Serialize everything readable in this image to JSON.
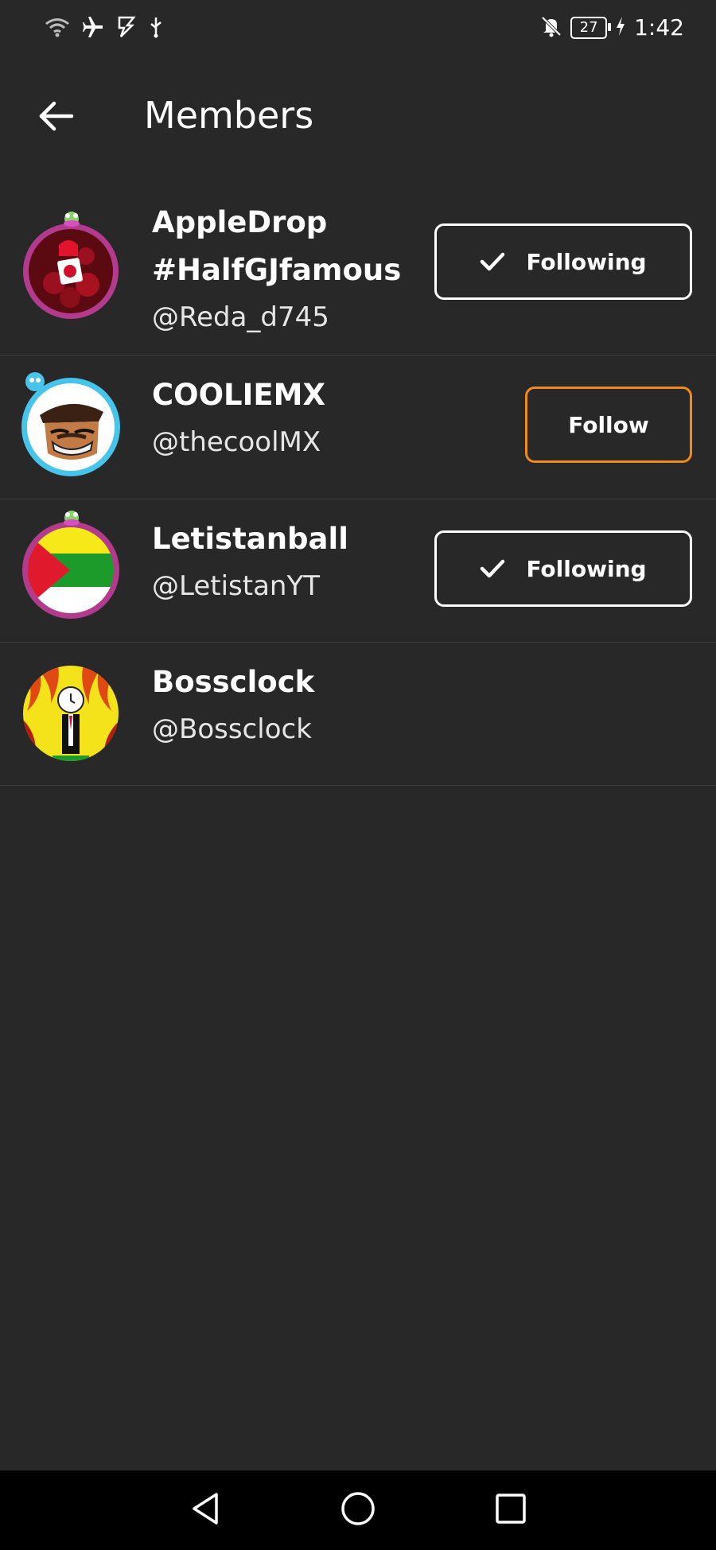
{
  "status_bar": {
    "battery_level": "27",
    "time": "1:42",
    "icons": [
      "wifi-icon",
      "airplane-icon",
      "flash-icon",
      "usb-icon",
      "bell-off-icon",
      "battery-icon",
      "charging-icon"
    ]
  },
  "header": {
    "title": "Members",
    "back_icon": "arrow-left-icon"
  },
  "members": [
    {
      "name": "AppleDrop #HalfGJfamous",
      "handle": "@Reda_d745",
      "button": "Following",
      "following": true
    },
    {
      "name": "COOLIEMX",
      "handle": "@thecoolMX",
      "button": "Follow",
      "following": false
    },
    {
      "name": "Letistanball",
      "handle": "@LetistanYT",
      "button": "Following",
      "following": true
    },
    {
      "name": "Bossclock",
      "handle": "@Bossclock",
      "button": null,
      "following": null
    }
  ],
  "nav_bar": {
    "icons": [
      "back-triangle-icon",
      "home-circle-icon",
      "recents-square-icon"
    ]
  },
  "colors": {
    "background": "#282828",
    "follow_accent": "#f08a1c",
    "divider": "#3e3e3e",
    "nav_background": "#000000"
  }
}
